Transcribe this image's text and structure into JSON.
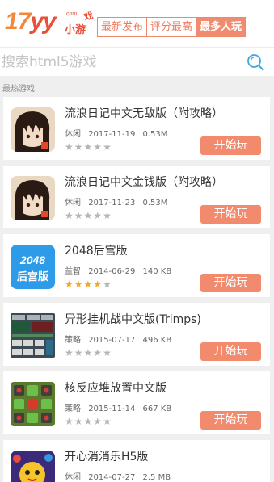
{
  "logo": {
    "number": "17",
    "yy": "yy",
    "dotcom": ".com",
    "text": "小游",
    "xi": "戏"
  },
  "tabs": [
    {
      "label": "最新发布",
      "active": false
    },
    {
      "label": "评分最高",
      "active": false
    },
    {
      "label": "最多人玩",
      "active": true
    }
  ],
  "search": {
    "placeholder": "搜索html5游戏"
  },
  "section_title": "最热游戏",
  "play_label": "开始玩",
  "games": [
    {
      "name": "流浪日记中文无敌版（附攻略）",
      "category": "休闲",
      "date": "2017-11-19",
      "size": "0.53M",
      "stars": 0,
      "icon": "anime-character-icon"
    },
    {
      "name": "流浪日记中文金钱版（附攻略）",
      "category": "休闲",
      "date": "2017-11-23",
      "size": "0.53M",
      "stars": 0,
      "icon": "anime-character-icon"
    },
    {
      "name": "2048后宫版",
      "category": "益智",
      "date": "2014-06-29",
      "size": "140 KB",
      "stars": 4,
      "icon": "2048-harem-icon",
      "icon_text": [
        "2048",
        "后宫版"
      ]
    },
    {
      "name": "异形挂机战中文版(Trimps)",
      "category": "策略",
      "date": "2015-07-17",
      "size": "496 KB",
      "stars": 0,
      "icon": "trimps-icon"
    },
    {
      "name": "核反应堆放置中文版",
      "category": "策略",
      "date": "2015-11-14",
      "size": "667 KB",
      "stars": 0,
      "icon": "reactor-icon"
    },
    {
      "name": "开心消消乐H5版",
      "category": "休闲",
      "date": "2014-07-27",
      "size": "2.5 MB",
      "stars": 0,
      "icon": "match-three-icon"
    }
  ],
  "colors": {
    "accent": "#f28b6d",
    "logo_orange": "#f0883e",
    "logo_red": "#e8503a",
    "star_on": "#f5a623",
    "star_off": "#b5b5b5"
  }
}
